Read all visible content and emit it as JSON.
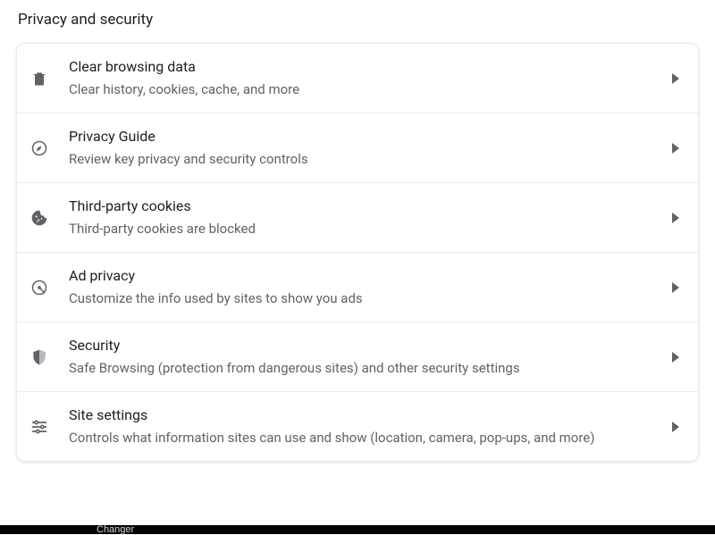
{
  "header": {
    "title": "Privacy and security"
  },
  "rows": [
    {
      "title": "Clear browsing data",
      "sub": "Clear history, cookies, cache, and more"
    },
    {
      "title": "Privacy Guide",
      "sub": "Review key privacy and security controls"
    },
    {
      "title": "Third-party cookies",
      "sub": "Third-party cookies are blocked"
    },
    {
      "title": "Ad privacy",
      "sub": "Customize the info used by sites to show you ads"
    },
    {
      "title": "Security",
      "sub": "Safe Browsing (protection from dangerous sites) and other security settings"
    },
    {
      "title": "Site settings",
      "sub": "Controls what information sites can use and show (location, camera, pop-ups, and more)"
    }
  ],
  "bottom": {
    "label": "Changer"
  }
}
